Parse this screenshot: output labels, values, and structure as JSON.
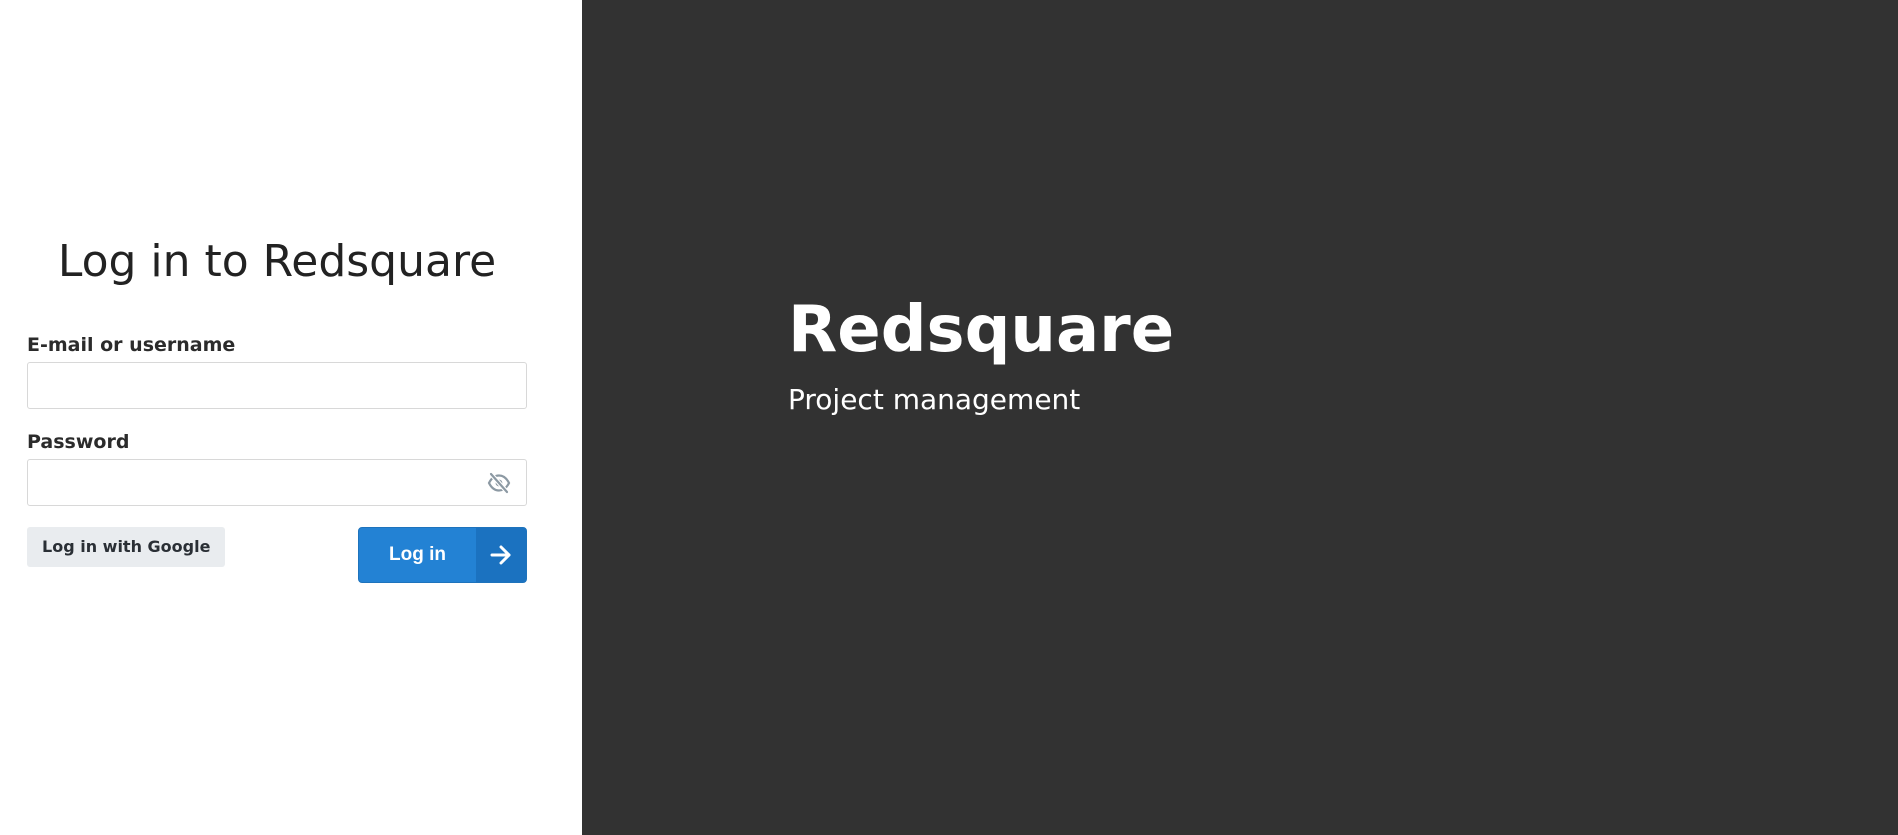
{
  "login": {
    "title": "Log in to Redsquare",
    "email_label": "E-mail or username",
    "email_value": "",
    "password_label": "Password",
    "password_value": "",
    "google_button_label": "Log in with Google",
    "login_button_label": "Log in"
  },
  "brand": {
    "name": "Redsquare",
    "tagline": "Project management"
  },
  "icons": {
    "password_toggle": "eye-slash-icon",
    "login_arrow": "arrow-right-icon"
  },
  "colors": {
    "primary": "#2382d4",
    "primary_dark": "#1b72c0",
    "brand_panel": "#323232",
    "secondary_button": "#e9ecef"
  }
}
